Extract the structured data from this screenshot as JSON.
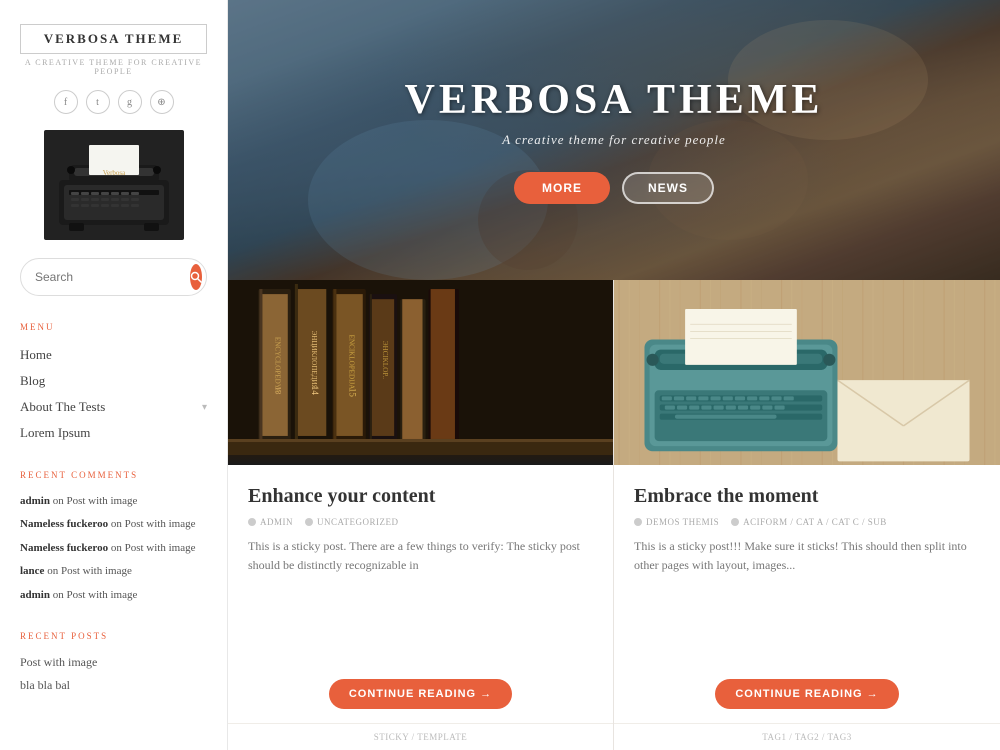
{
  "sidebar": {
    "logo_title": "VERBOSA THEME",
    "logo_subtitle": "A CREATIVE THEME FOR CREATIVE PEOPLE",
    "social_icons": [
      "f",
      "t",
      "g+",
      "🔗"
    ],
    "search_placeholder": "Search",
    "menu_title": "MENU",
    "menu_items": [
      {
        "label": "Home",
        "has_arrow": false
      },
      {
        "label": "Blog",
        "has_arrow": false
      },
      {
        "label": "About The Tests",
        "has_arrow": true
      },
      {
        "label": "Lorem Ipsum",
        "has_arrow": false
      }
    ],
    "recent_comments_title": "RECENT COMMENTS",
    "recent_comments": [
      {
        "author": "admin",
        "text": "on Post with image"
      },
      {
        "author": "Nameless fuckeroo",
        "text": "on Post with image"
      },
      {
        "author": "Nameless fuckeroo",
        "text": "on Post with image"
      },
      {
        "author": "lance",
        "text": "on Post with image"
      },
      {
        "author": "admin",
        "text": "on Post with image"
      }
    ],
    "recent_posts_title": "RECENT POSTS",
    "recent_posts": [
      "Post with image",
      "bla bla bal"
    ]
  },
  "hero": {
    "title": "VERBOSA THEME",
    "subtitle": "A creative theme for creative people",
    "btn_more": "MORE",
    "btn_news": "NEWS"
  },
  "cards": [
    {
      "id": "card-1",
      "title": "Enhance your content",
      "meta_author": "ADMIN",
      "meta_category": "UNCATEGORIZED",
      "excerpt": "This is a sticky post. There are a few things to verify: The sticky post should be distinctly recognizable in",
      "btn_label": "CONTINUE READING →",
      "footer": "STICKY / TEMPLATE"
    },
    {
      "id": "card-2",
      "title": "Embrace the moment",
      "meta_author": "DEMOS THEMIS",
      "meta_category": "ACIFORM / CAT A / CAT C / SUB",
      "excerpt": "This is a sticky post!!! Make sure it sticks! This should then split into other pages with layout, images...",
      "btn_label": "CONTINUE READING →",
      "footer": "TAG1 / TAG2 / TAG3"
    }
  ],
  "colors": {
    "accent": "#e8603c",
    "text_primary": "#333",
    "text_secondary": "#777",
    "text_muted": "#aaa"
  }
}
